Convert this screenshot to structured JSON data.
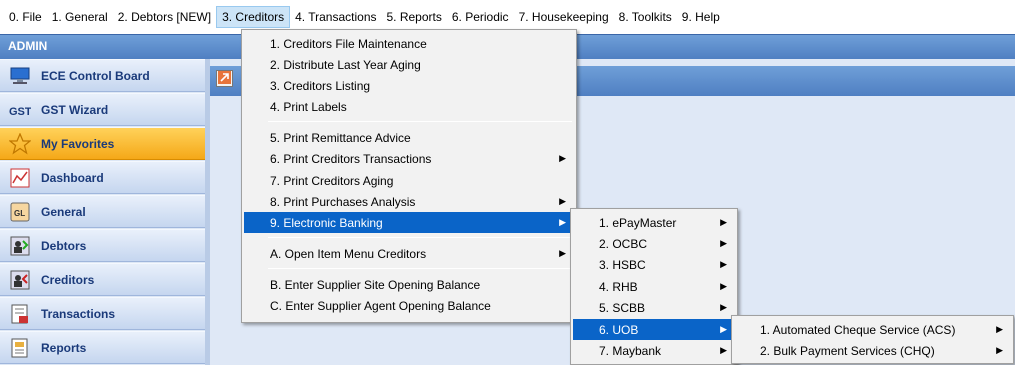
{
  "menubar": {
    "items": [
      {
        "label": "0. File"
      },
      {
        "label": "1. General"
      },
      {
        "label": "2. Debtors [NEW]"
      },
      {
        "label": "3. Creditors",
        "active": true
      },
      {
        "label": "4. Transactions"
      },
      {
        "label": "5. Reports"
      },
      {
        "label": "6. Periodic"
      },
      {
        "label": "7. Housekeeping"
      },
      {
        "label": "8. Toolkits"
      },
      {
        "label": "9. Help"
      }
    ]
  },
  "header": {
    "title": "ADMIN"
  },
  "sidebar": {
    "items": [
      {
        "label": "ECE Control Board",
        "icon": "control-board-icon"
      },
      {
        "label": "GST Wizard",
        "icon": "gst-icon"
      },
      {
        "label": "My Favorites",
        "icon": "star-icon",
        "selected": true
      },
      {
        "label": "Dashboard",
        "icon": "dashboard-icon"
      },
      {
        "label": "General",
        "icon": "gl-icon"
      },
      {
        "label": "Debtors",
        "icon": "debtors-icon"
      },
      {
        "label": "Creditors",
        "icon": "creditors-icon"
      },
      {
        "label": "Transactions",
        "icon": "transactions-icon"
      },
      {
        "label": "Reports",
        "icon": "reports-icon"
      }
    ]
  },
  "creditors_menu": {
    "items": [
      {
        "label": "1. Creditors File Maintenance"
      },
      {
        "label": "2. Distribute Last Year Aging"
      },
      {
        "label": "3. Creditors Listing"
      },
      {
        "label": "4. Print Labels"
      },
      {
        "label": "5. Print Remittance Advice"
      },
      {
        "label": "6. Print Creditors Transactions",
        "submenu": true
      },
      {
        "label": "7. Print Creditors Aging"
      },
      {
        "label": "8. Print Purchases Analysis",
        "submenu": true
      },
      {
        "label": "9. Electronic Banking",
        "submenu": true,
        "highlighted": true
      },
      {
        "label": "A. Open Item Menu Creditors",
        "submenu": true
      },
      {
        "label": "B. Enter Supplier Site Opening Balance"
      },
      {
        "label": "C. Enter Supplier Agent Opening Balance"
      }
    ]
  },
  "banking_menu": {
    "items": [
      {
        "label": "1. ePayMaster"
      },
      {
        "label": "2. OCBC"
      },
      {
        "label": "3. HSBC"
      },
      {
        "label": "4. RHB"
      },
      {
        "label": "5. SCBB"
      },
      {
        "label": "6. UOB",
        "highlighted": true
      },
      {
        "label": "7. Maybank"
      }
    ]
  },
  "uob_menu": {
    "items": [
      {
        "label": "1. Automated Cheque Service (ACS)"
      },
      {
        "label": "2. Bulk Payment Services (CHQ)"
      }
    ]
  },
  "arrow_glyph": "▶"
}
